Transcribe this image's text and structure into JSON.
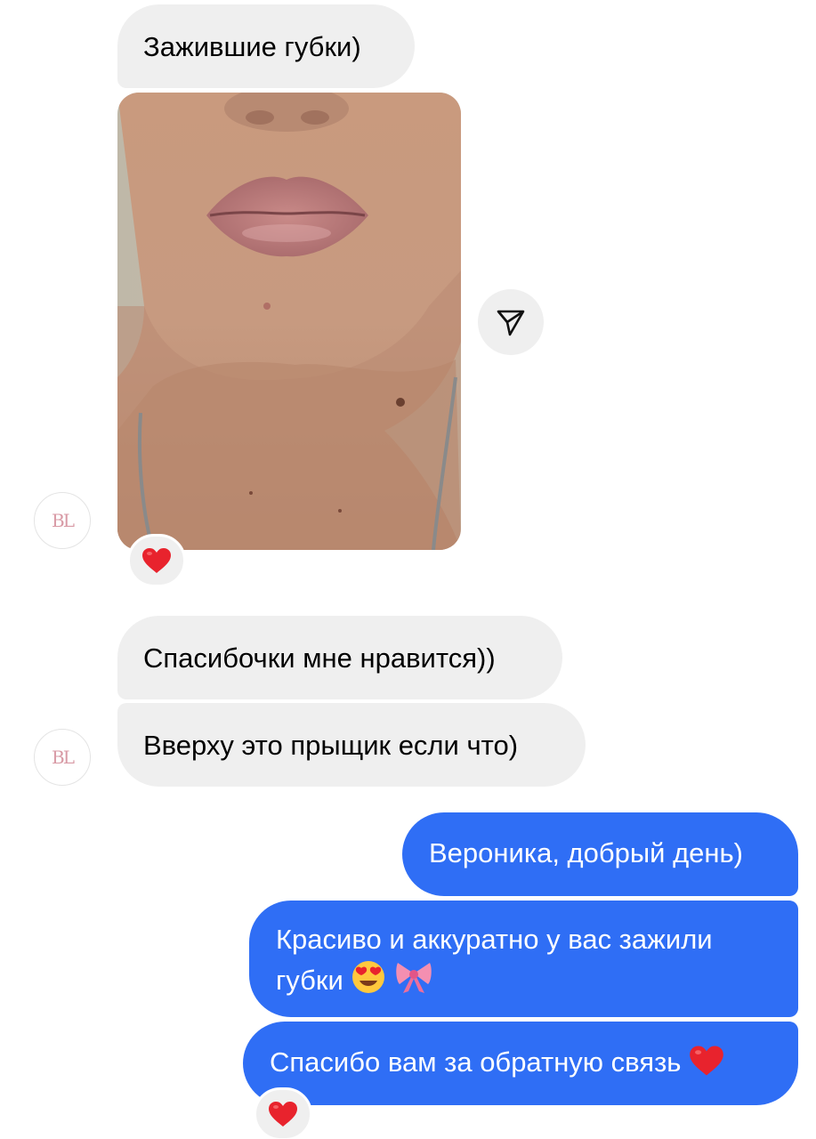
{
  "messages": {
    "m1": "Зажившие губки)",
    "m2": "Спасибочки мне нравится))",
    "m3": "Вверху это прыщик если что)",
    "m4": "Вероника, добрый день)",
    "m5_line1": "Красиво и аккуратно у вас зажили",
    "m5_line2": "губки",
    "m6": "Спасибо вам за обратную связь"
  },
  "avatar": {
    "monogram": "BL"
  },
  "icons": {
    "share": "paper-plane-icon",
    "reaction": "red-heart-icon",
    "m5_emojis": [
      "heart-eyes-emoji-icon",
      "ribbon-emoji-icon"
    ],
    "m6_emoji": "red-heart-icon"
  },
  "colors": {
    "incoming_bubble": "#efefef",
    "outgoing_bubble": "#2f6ef5",
    "heart": "#e8232d"
  }
}
